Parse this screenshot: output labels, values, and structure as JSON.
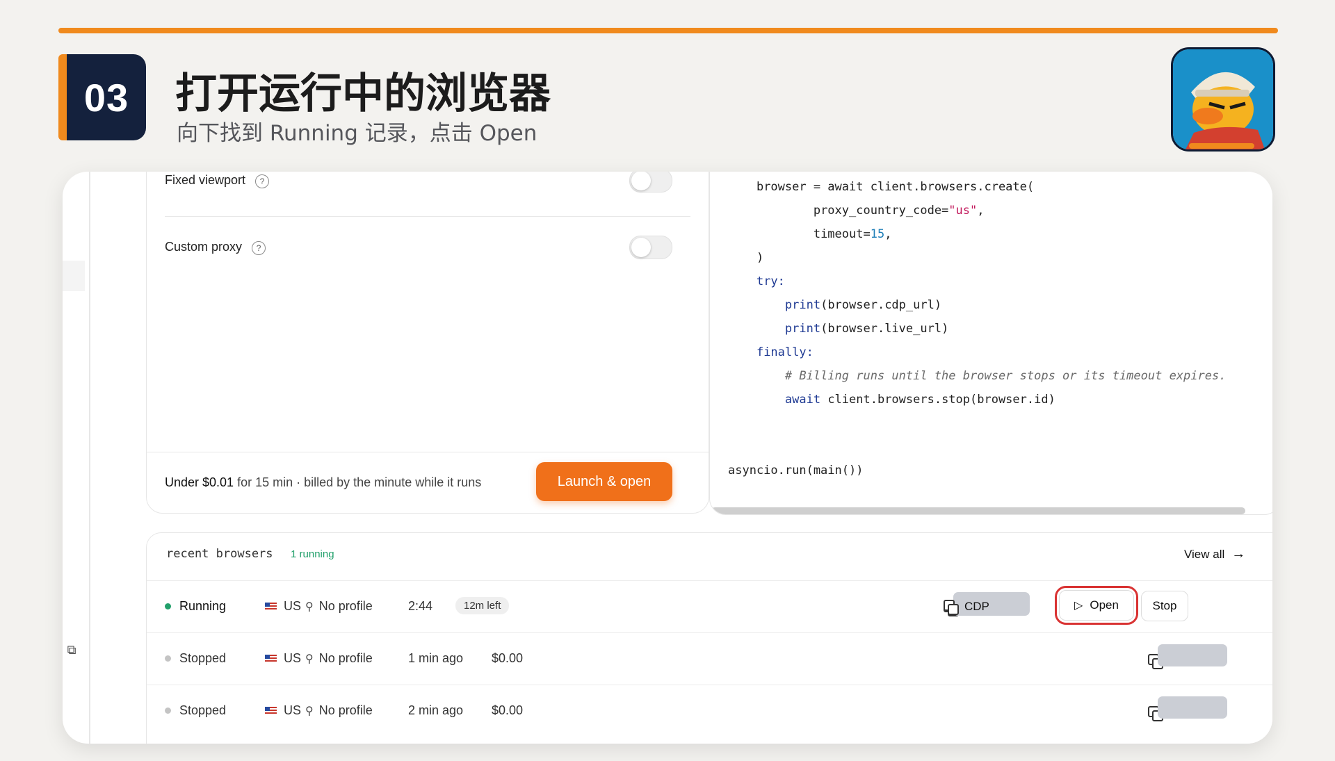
{
  "step": {
    "number": "03",
    "title": "打开运行中的浏览器",
    "subtitle": "向下找到 Running 记录，点击 Open"
  },
  "settings": {
    "fixed_viewport_label": "Fixed viewport",
    "custom_proxy_label": "Custom proxy",
    "help_symbol": "?",
    "price_bold": "Under $0.01",
    "price_rest": " for 15 min · billed by the minute while it runs",
    "launch_label": "Launch & open"
  },
  "code": {
    "line1": "browser = await client.browsers.create(",
    "line2_a": "    proxy_country_code=",
    "line2_str": "\"us\"",
    "line2_b": ",",
    "line3_a": "    timeout=",
    "line3_num": "15",
    "line3_b": ",",
    "line4": ")",
    "line5": "try:",
    "line6_kw": "    print",
    "line6_rest": "(browser.cdp_url)",
    "line7_kw": "    print",
    "line7_rest": "(browser.live_url)",
    "line8": "finally:",
    "line9": "    # Billing runs until the browser stops or its timeout expires.",
    "line10_kw": "    await",
    "line10_rest": " client.browsers.stop(browser.id)",
    "line11": "asyncio.run(main())"
  },
  "recent": {
    "title": "recent browsers",
    "running_count": "1 running",
    "view_all": "View all",
    "rows": [
      {
        "status": "Running",
        "country": "US",
        "profile": "No profile",
        "time": "2:44",
        "badge": "12m left",
        "status_color": "#22a06b"
      },
      {
        "status": "Stopped",
        "country": "US",
        "profile": "No profile",
        "time": "1 min ago",
        "cost": "$0.00",
        "status_color": "#c4c4c4"
      },
      {
        "status": "Stopped",
        "country": "US",
        "profile": "No profile",
        "time": "2 min ago",
        "cost": "$0.00",
        "status_color": "#c4c4c4"
      }
    ],
    "actions": {
      "cdp": "CDP",
      "open": "Open",
      "stop": "Stop"
    }
  },
  "colors": {
    "accent": "#f08a1d",
    "badge_bg": "#14213d",
    "launch": "#f0701a",
    "highlight": "#d93333"
  }
}
